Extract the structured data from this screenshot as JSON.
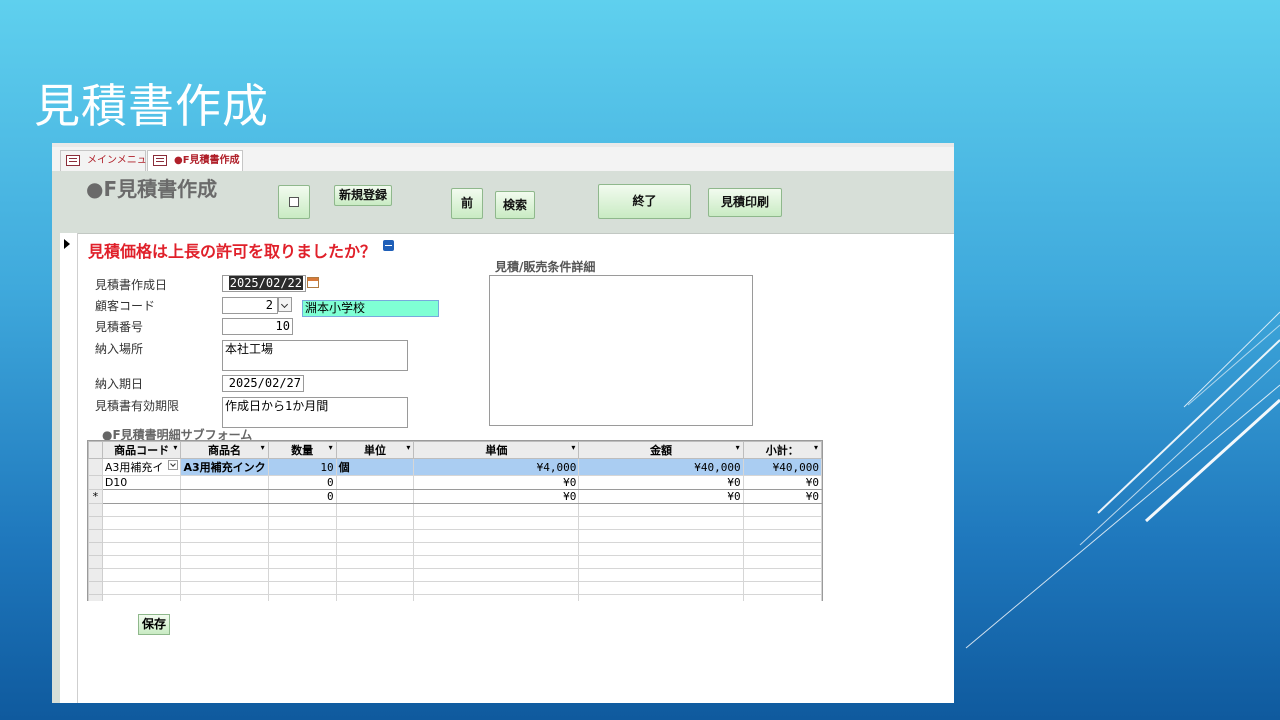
{
  "slide": {
    "title": "見積書作成"
  },
  "tabs": [
    {
      "label": "メインメニュー"
    },
    {
      "label": "●F見積書作成"
    }
  ],
  "form": {
    "title": "●F見積書作成",
    "buttons": {
      "icon_button": "",
      "new_register": "新規登録",
      "prev": "前",
      "search": "検索",
      "finish": "終了",
      "print_quote": "見積印刷"
    },
    "warning": "見積価格は上長の許可を取りましたか？",
    "fields": {
      "created_date_label": "見積書作成日",
      "created_date": "2025/02/22",
      "customer_code_label": "顧客コード",
      "customer_code": "2",
      "customer_name": "淵本小学校",
      "quote_no_label": "見積番号",
      "quote_no": "10",
      "delivery_place_label": "納入場所",
      "delivery_place": "本社工場",
      "delivery_date_label": "納入期日",
      "delivery_date": "2025/02/27",
      "validity_label": "見積書有効期限",
      "validity": "作成日から1か月間",
      "details_label": "見積/販売条件詳細",
      "details": ""
    },
    "subform": {
      "label": "●F見積書明細サブフォーム",
      "columns": [
        "商品コード",
        "商品名",
        "数量",
        "単位",
        "単価",
        "金額",
        "小計："
      ],
      "rows": [
        {
          "code": "A3用補充イ",
          "name": "A3用補充インク",
          "qty": "10",
          "unit": "個",
          "price": "¥4,000",
          "amount": "¥40,000",
          "subtotal": "¥40,000"
        },
        {
          "code": "D10",
          "name": "",
          "qty": "0",
          "unit": "",
          "price": "¥0",
          "amount": "¥0",
          "subtotal": "¥0"
        }
      ],
      "new_row": {
        "marker": "*",
        "qty": "0",
        "price": "¥0",
        "amount": "¥0",
        "subtotal": "¥0"
      }
    },
    "save_button": "保存"
  },
  "colors": {
    "header_bg": "#d7dfd8",
    "warning": "#e0202a",
    "customer_name_bg": "#7fffd4",
    "highlight_row": "#aacdf2"
  }
}
